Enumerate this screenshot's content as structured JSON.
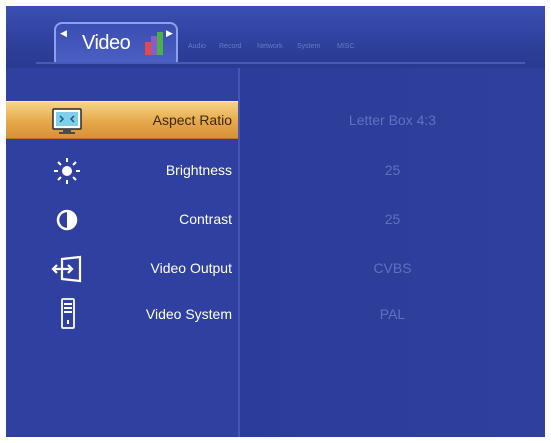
{
  "tabs": {
    "active": "Video",
    "others": [
      "Audio",
      "Record",
      "Network",
      "System",
      "MISC"
    ]
  },
  "menu": [
    {
      "label": "Aspect Ratio",
      "value": "Letter Box 4:3",
      "icon": "aspect-ratio-icon",
      "selected": true
    },
    {
      "label": "Brightness",
      "value": "25",
      "icon": "brightness-icon",
      "selected": false
    },
    {
      "label": "Contrast",
      "value": "25",
      "icon": "contrast-icon",
      "selected": false
    },
    {
      "label": "Video Output",
      "value": "CVBS",
      "icon": "video-output-icon",
      "selected": false
    },
    {
      "label": "Video System",
      "value": "PAL",
      "icon": "video-system-icon",
      "selected": false
    }
  ],
  "colors": {
    "background": "#2e3f9c",
    "highlight": "#e6a84a",
    "value_text": "#5f70c2"
  }
}
